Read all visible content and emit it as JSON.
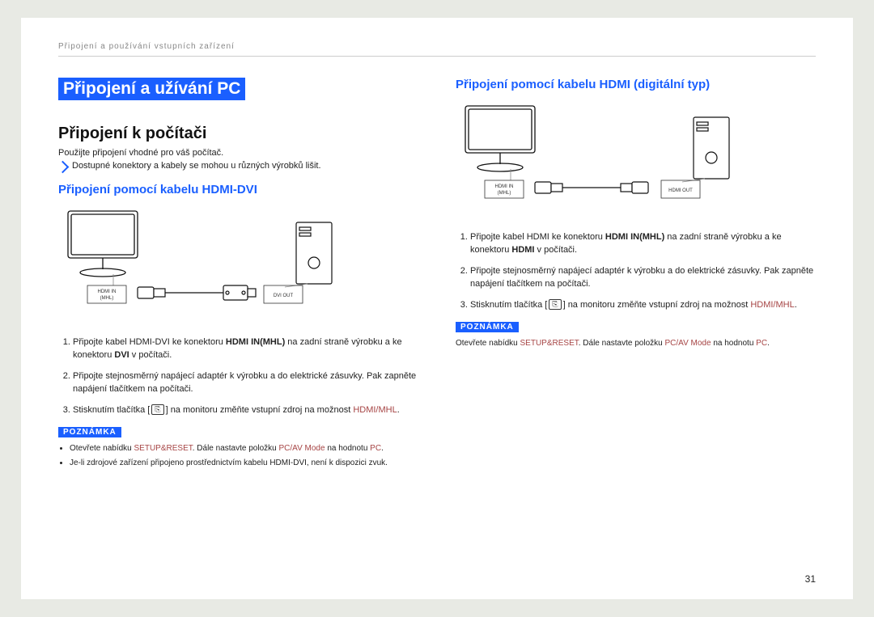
{
  "breadcrumb": "Připojení a používání vstupních zařízení",
  "page_number": "31",
  "banner_title": "Připojení a užívání PC",
  "left": {
    "h2": "Připojení k počítači",
    "lead": "Použijte připojení vhodné pro váš počítač.",
    "bullet": "Dostupné konektory a kabely se mohou u různých výrobků lišit.",
    "h3": "Připojení pomocí kabelu HDMI-DVI",
    "diagram": {
      "monitor_port_l1": "HDMI IN",
      "monitor_port_l2": "(MHL)",
      "pc_port": "DVI OUT"
    },
    "step1_a": "Připojte kabel HDMI-DVI ke konektoru ",
    "step1_b": "HDMI IN(MHL)",
    "step1_c": " na zadní straně výrobku a ke konektoru ",
    "step1_d": "DVI",
    "step1_e": " v počítači.",
    "step2": "Připojte stejnosměrný napájecí adaptér k výrobku a do elektrické zásuvky. Pak zapněte napájení tlačítkem na počítači.",
    "step3_a": "Stisknutím tlačítka [",
    "step3_b": "] na monitoru změňte vstupní zdroj na možnost ",
    "step3_c": "HDMI/MHL",
    "step3_d": ".",
    "icon_glyph": "⎘",
    "note_label": "POZNÁMKA",
    "note1_a": "Otevřete nabídku ",
    "note1_b": "SETUP&RESET",
    "note1_c": ". Dále nastavte položku ",
    "note1_d": "PC/AV Mode",
    "note1_e": " na hodnotu ",
    "note1_f": "PC",
    "note1_g": ".",
    "note2": "Je-li zdrojové zařízení připojeno prostřednictvím kabelu HDMI-DVI, není k dispozici zvuk."
  },
  "right": {
    "h3": "Připojení pomocí kabelu HDMI (digitální typ)",
    "diagram": {
      "monitor_port_l1": "HDMI IN",
      "monitor_port_l2": "(MHL)",
      "pc_port": "HDMI OUT"
    },
    "step1_a": "Připojte kabel HDMI ke konektoru ",
    "step1_b": "HDMI IN(MHL)",
    "step1_c": " na zadní straně výrobku a ke konektoru ",
    "step1_d": "HDMI",
    "step1_e": " v počítači.",
    "step2": "Připojte stejnosměrný napájecí adaptér k výrobku a do elektrické zásuvky. Pak zapněte napájení tlačítkem na počítači.",
    "step3_a": "Stisknutím tlačítka [",
    "step3_b": "] na monitoru změňte vstupní zdroj na možnost ",
    "step3_c": "HDMI/MHL",
    "step3_d": ".",
    "icon_glyph": "⎘",
    "note_label": "POZNÁMKA",
    "noter_a": "Otevřete nabídku ",
    "noter_b": "SETUP&RESET",
    "noter_c": ". Dále nastavte položku ",
    "noter_d": "PC/AV Mode",
    "noter_e": " na hodnotu ",
    "noter_f": "PC",
    "noter_g": "."
  }
}
